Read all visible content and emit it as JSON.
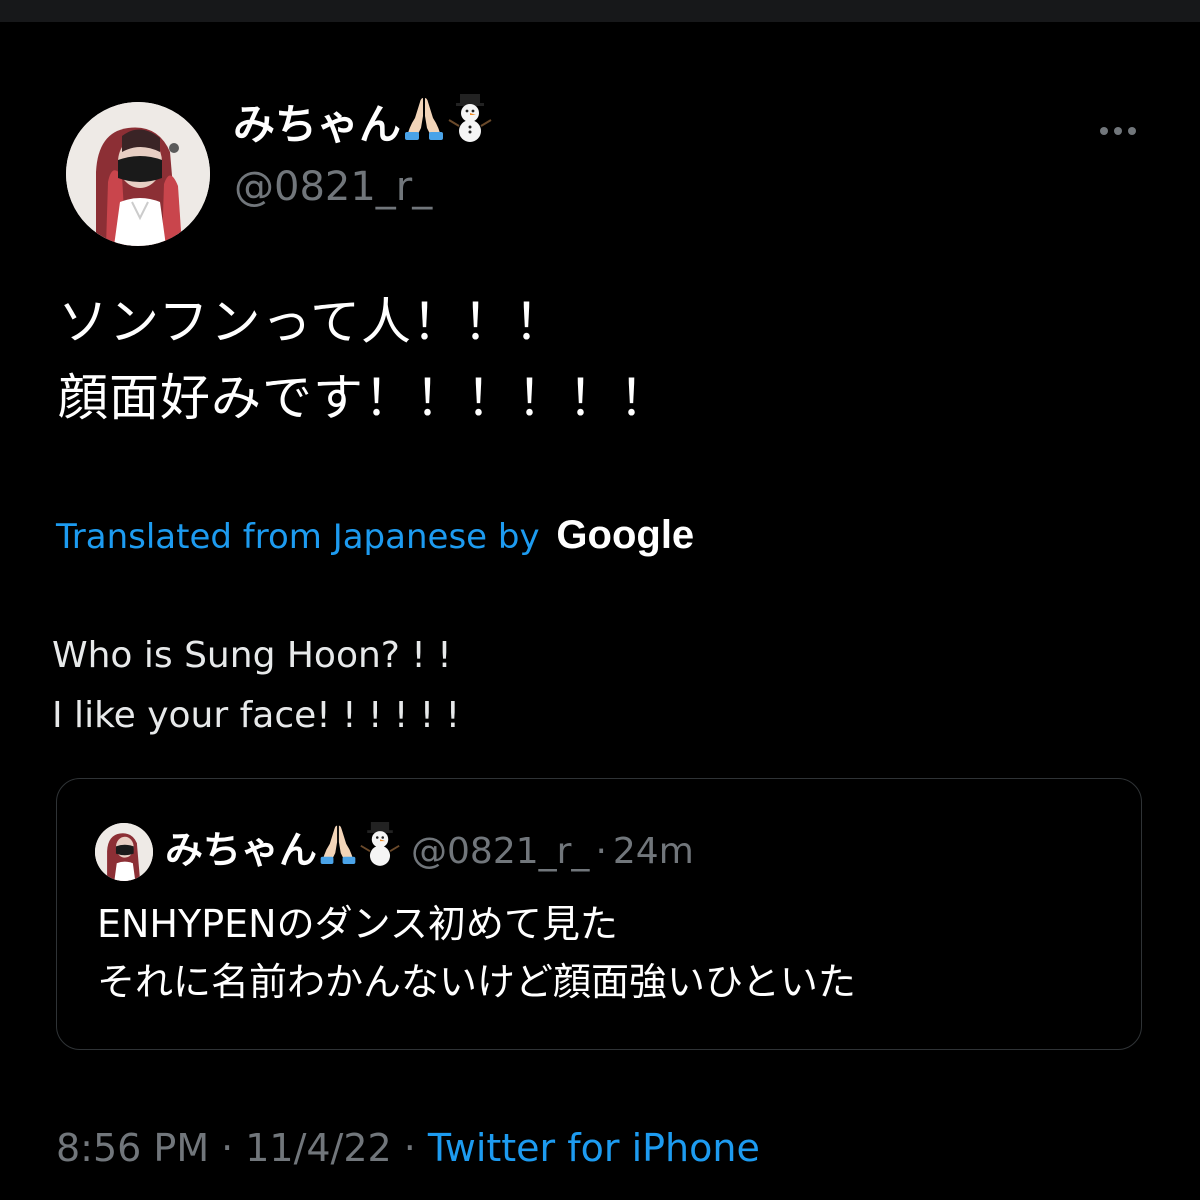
{
  "tweet": {
    "display_name": "みちゃん",
    "name_emojis": [
      "folded-hands-icon",
      "snowman-icon"
    ],
    "username": "@0821_r_",
    "text_lines": [
      "ソンフンって人！！！",
      "顔面好みです！！！！！！"
    ],
    "translation_label": "Translated from Japanese by",
    "translation_provider": "Google",
    "translation_lines": [
      "Who is Sung Hoon? ! !",
      "I like your face! ! ! ! ! !"
    ],
    "timestamp_time": "8:56 PM",
    "timestamp_date": "11/4/22",
    "source": "Twitter for iPhone"
  },
  "quoted_tweet": {
    "display_name": "みちゃん",
    "username": "@0821_r_",
    "separator": "·",
    "age": "24m",
    "text_lines": [
      "ENHYPENのダンス初めて見た",
      "それに名前わかんないけど顔面強いひといた"
    ]
  },
  "colors": {
    "background": "#000000",
    "accent": "#1d9bf0",
    "secondary_text": "#71767b",
    "border": "#2f3336"
  }
}
